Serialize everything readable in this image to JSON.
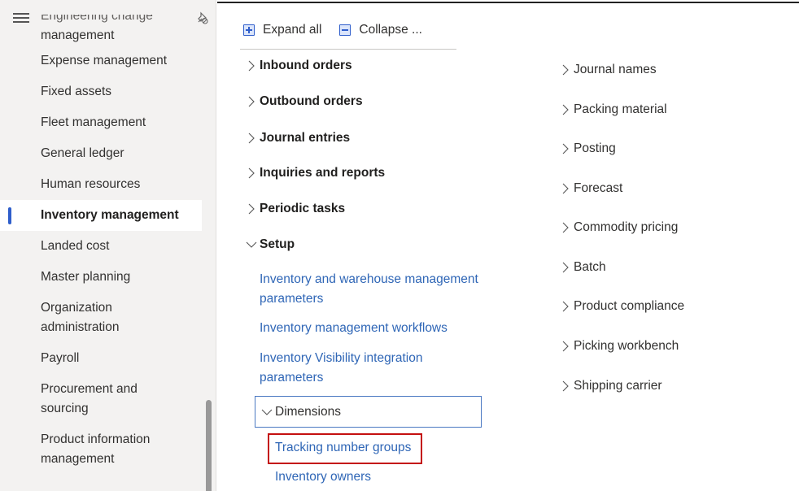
{
  "sidebar": {
    "menu_icon": "hamburger-icon",
    "pin_icon": "pin-icon",
    "partial_item": "Engineering change",
    "items": [
      {
        "label": "management",
        "type": "continuation"
      },
      {
        "label": "Expense management"
      },
      {
        "label": "Fixed assets"
      },
      {
        "label": "Fleet management"
      },
      {
        "label": "General ledger"
      },
      {
        "label": "Human resources"
      },
      {
        "label": "Inventory management",
        "active": true
      },
      {
        "label": "Landed cost"
      },
      {
        "label": "Master planning"
      },
      {
        "label": "Organization administration"
      },
      {
        "label": "Payroll"
      },
      {
        "label": "Procurement and sourcing"
      },
      {
        "label": "Product information management"
      }
    ]
  },
  "toolbar": {
    "expand_all": "Expand all",
    "collapse_all": "Collapse ..."
  },
  "left_groups": [
    {
      "label": "Inbound orders",
      "expanded": false
    },
    {
      "label": "Outbound orders",
      "expanded": false
    },
    {
      "label": "Journal entries",
      "expanded": false
    },
    {
      "label": "Inquiries and reports",
      "expanded": false
    },
    {
      "label": "Periodic tasks",
      "expanded": false
    },
    {
      "label": "Setup",
      "expanded": true
    }
  ],
  "setup_links": [
    {
      "line1": "Inventory and warehouse management",
      "line2": "parameters"
    },
    {
      "line1": "Inventory management workflows"
    },
    {
      "line1": "Inventory Visibility integration",
      "line2": "parameters"
    }
  ],
  "dimensions": {
    "label": "Dimensions",
    "expanded": true,
    "links": [
      "Tracking number groups",
      "Inventory owners"
    ],
    "highlighted": "Tracking number groups"
  },
  "right_groups": [
    "Journal names",
    "Packing material",
    "Posting",
    "Forecast",
    "Commodity pricing",
    "Batch",
    "Product compliance",
    "Picking workbench",
    "Shipping carrier"
  ],
  "colors": {
    "accent": "#2f5ecb",
    "link": "#2f66b6",
    "highlight_border": "#c40f0f",
    "sidebar_bg": "#f3f2f1"
  }
}
